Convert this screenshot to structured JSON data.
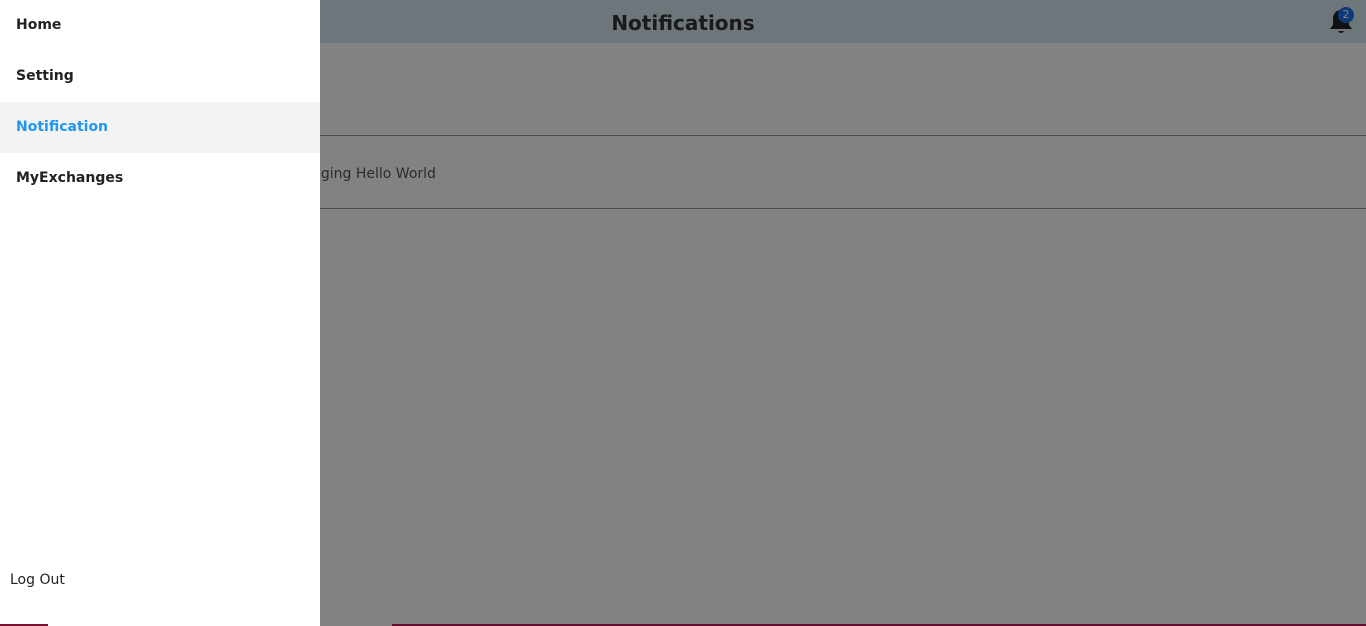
{
  "header": {
    "title": "Notifications",
    "bell_icon": "bell-icon",
    "badge_count": "2"
  },
  "notifications": [
    {
      "text": ""
    },
    {
      "text": "nging Hello World"
    }
  ],
  "drawer": {
    "items": [
      {
        "label": "Home"
      },
      {
        "label": "Setting"
      },
      {
        "label": "Notification",
        "active": true
      },
      {
        "label": "MyExchanges"
      }
    ],
    "logout_label": "Log Out",
    "active_color": "#2196f3"
  }
}
